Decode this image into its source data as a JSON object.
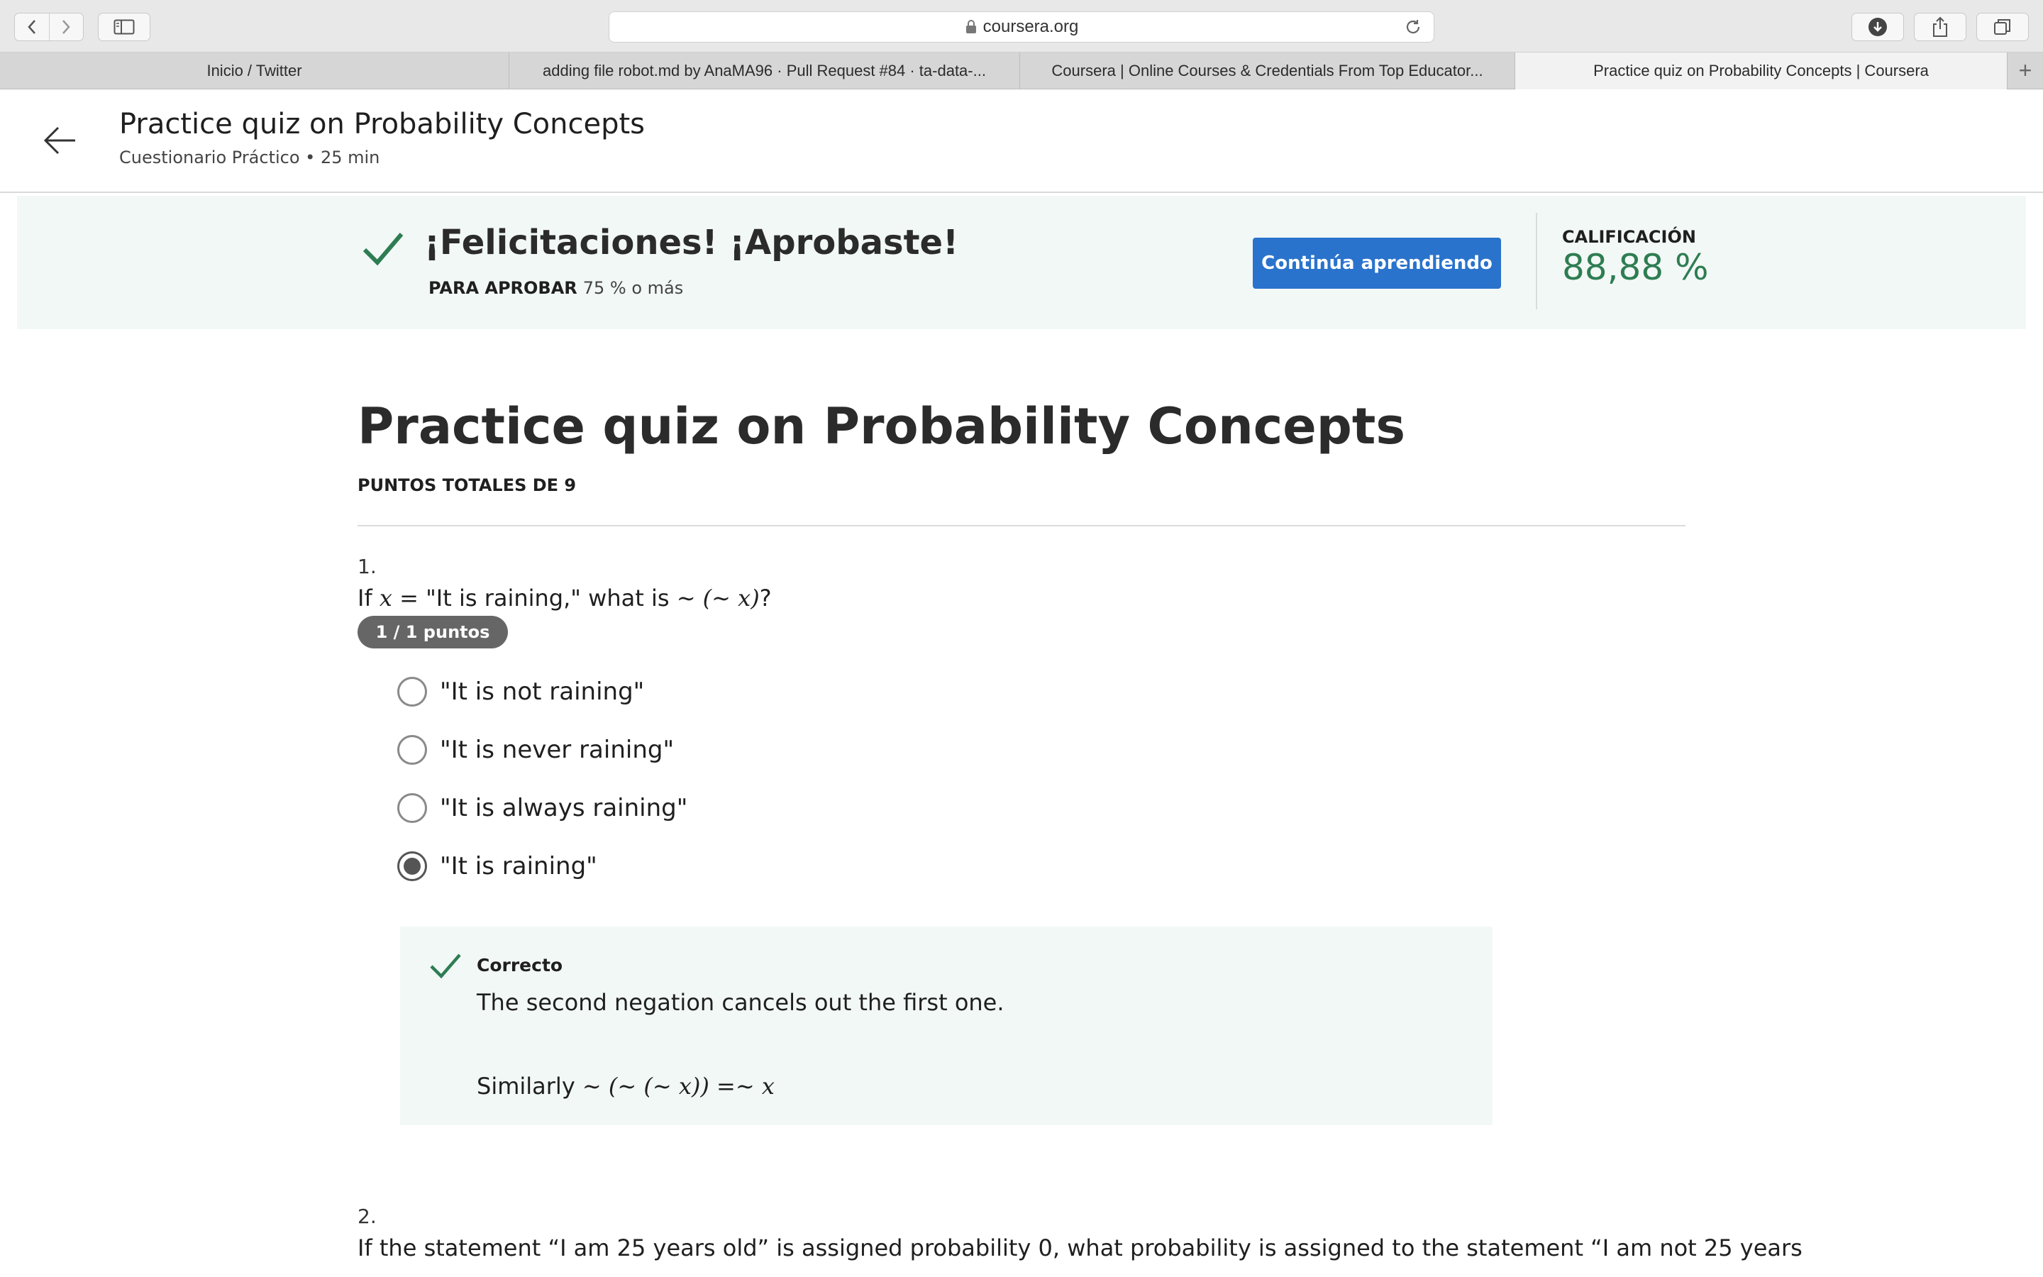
{
  "browser": {
    "url": "coursera.org",
    "tabs": [
      {
        "label": "Inicio / Twitter",
        "active": false
      },
      {
        "label": "adding file robot.md by AnaMA96 · Pull Request #84 · ta-data-...",
        "active": false
      },
      {
        "label": "Coursera | Online Courses & Credentials From Top Educator...",
        "active": false
      },
      {
        "label": "Practice quiz on Probability Concepts | Coursera",
        "active": true
      }
    ]
  },
  "header": {
    "title": "Practice quiz on Probability Concepts",
    "subtitle": "Cuestionario Práctico • 25 min"
  },
  "banner": {
    "title": "¡Felicitaciones! ¡Aprobaste!",
    "pass_label": "PARA APROBAR",
    "pass_value": "75 % o más",
    "continue_button": "Continúa aprendiendo",
    "grade_label": "CALIFICACIÓN",
    "grade_value": "88,88 %",
    "accent_color": "#2e7d52",
    "button_color": "#2a73cc"
  },
  "quiz": {
    "title": "Practice quiz on Probability Concepts",
    "total_points": "PUNTOS TOTALES DE 9",
    "questions": [
      {
        "number": "1.",
        "text_prefix": "If ",
        "text_math1": "x = ",
        "text_mid": "\"It is raining,\" what is ",
        "text_math2": "∼ (∼ x)",
        "text_suffix": "?",
        "points": "1 / 1 puntos",
        "options": [
          {
            "label": "\"It is not raining\"",
            "selected": false
          },
          {
            "label": "\"It is never raining\"",
            "selected": false
          },
          {
            "label": "\"It is always raining\"",
            "selected": false
          },
          {
            "label": "\"It is raining\"",
            "selected": true
          }
        ],
        "feedback": {
          "status": "Correcto",
          "text": "The second negation cancels out the first one.",
          "text2_prefix": "Similarly ",
          "text2_math": "∼ (∼ (∼ x)) =∼ x"
        }
      },
      {
        "number": "2.",
        "text": "If the statement “I am 25 years old” is assigned probability 0, what probability is assigned to the statement “I am not 25 years"
      }
    ]
  }
}
